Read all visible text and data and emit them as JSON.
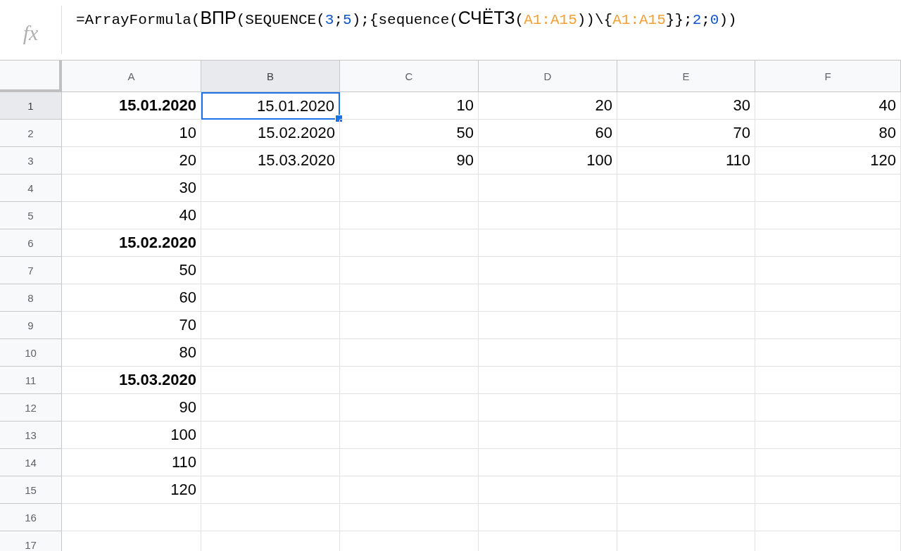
{
  "formula_bar": {
    "icon_label": "fx",
    "tokens": [
      {
        "text": "=ArrayFormula(",
        "kind": "code"
      },
      {
        "text": "ВПР",
        "kind": "name"
      },
      {
        "text": "(SEQUENCE(",
        "kind": "code"
      },
      {
        "text": "3",
        "kind": "number"
      },
      {
        "text": ";",
        "kind": "code"
      },
      {
        "text": "5",
        "kind": "number"
      },
      {
        "text": ");{sequence(",
        "kind": "code"
      },
      {
        "text": "СЧЁТЗ",
        "kind": "name"
      },
      {
        "text": "(",
        "kind": "code"
      },
      {
        "text": "A1:A15",
        "kind": "range"
      },
      {
        "text": "))\\{",
        "kind": "code"
      },
      {
        "text": "A1:A15",
        "kind": "range"
      },
      {
        "text": "}};",
        "kind": "code"
      },
      {
        "text": "2",
        "kind": "number"
      },
      {
        "text": ";",
        "kind": "code"
      },
      {
        "text": "0",
        "kind": "number"
      },
      {
        "text": "))",
        "kind": "code"
      }
    ]
  },
  "columns": [
    {
      "label": "A",
      "selected": false
    },
    {
      "label": "B",
      "selected": true
    },
    {
      "label": "C",
      "selected": false
    },
    {
      "label": "D",
      "selected": false
    },
    {
      "label": "E",
      "selected": false
    },
    {
      "label": "F",
      "selected": false
    }
  ],
  "rows": [
    {
      "number": "1",
      "selected": true,
      "cells": [
        {
          "value": "15.01.2020",
          "bold": true,
          "selected": false
        },
        {
          "value": "15.01.2020",
          "bold": false,
          "selected": true
        },
        {
          "value": "10",
          "bold": false,
          "selected": false
        },
        {
          "value": "20",
          "bold": false,
          "selected": false
        },
        {
          "value": "30",
          "bold": false,
          "selected": false
        },
        {
          "value": "40",
          "bold": false,
          "selected": false
        }
      ]
    },
    {
      "number": "2",
      "selected": false,
      "cells": [
        {
          "value": "10",
          "bold": false,
          "selected": false
        },
        {
          "value": "15.02.2020",
          "bold": false,
          "selected": false
        },
        {
          "value": "50",
          "bold": false,
          "selected": false
        },
        {
          "value": "60",
          "bold": false,
          "selected": false
        },
        {
          "value": "70",
          "bold": false,
          "selected": false
        },
        {
          "value": "80",
          "bold": false,
          "selected": false
        }
      ]
    },
    {
      "number": "3",
      "selected": false,
      "cells": [
        {
          "value": "20",
          "bold": false,
          "selected": false
        },
        {
          "value": "15.03.2020",
          "bold": false,
          "selected": false
        },
        {
          "value": "90",
          "bold": false,
          "selected": false
        },
        {
          "value": "100",
          "bold": false,
          "selected": false
        },
        {
          "value": "110",
          "bold": false,
          "selected": false
        },
        {
          "value": "120",
          "bold": false,
          "selected": false
        }
      ]
    },
    {
      "number": "4",
      "selected": false,
      "cells": [
        {
          "value": "30",
          "bold": false,
          "selected": false
        }
      ]
    },
    {
      "number": "5",
      "selected": false,
      "cells": [
        {
          "value": "40",
          "bold": false,
          "selected": false
        }
      ]
    },
    {
      "number": "6",
      "selected": false,
      "cells": [
        {
          "value": "15.02.2020",
          "bold": true,
          "selected": false
        }
      ]
    },
    {
      "number": "7",
      "selected": false,
      "cells": [
        {
          "value": "50",
          "bold": false,
          "selected": false
        }
      ]
    },
    {
      "number": "8",
      "selected": false,
      "cells": [
        {
          "value": "60",
          "bold": false,
          "selected": false
        }
      ]
    },
    {
      "number": "9",
      "selected": false,
      "cells": [
        {
          "value": "70",
          "bold": false,
          "selected": false
        }
      ]
    },
    {
      "number": "10",
      "selected": false,
      "cells": [
        {
          "value": "80",
          "bold": false,
          "selected": false
        }
      ]
    },
    {
      "number": "11",
      "selected": false,
      "cells": [
        {
          "value": "15.03.2020",
          "bold": true,
          "selected": false
        }
      ]
    },
    {
      "number": "12",
      "selected": false,
      "cells": [
        {
          "value": "90",
          "bold": false,
          "selected": false
        }
      ]
    },
    {
      "number": "13",
      "selected": false,
      "cells": [
        {
          "value": "100",
          "bold": false,
          "selected": false
        }
      ]
    },
    {
      "number": "14",
      "selected": false,
      "cells": [
        {
          "value": "110",
          "bold": false,
          "selected": false
        }
      ]
    },
    {
      "number": "15",
      "selected": false,
      "cells": [
        {
          "value": "120",
          "bold": false,
          "selected": false
        }
      ]
    },
    {
      "number": "16",
      "selected": false,
      "cells": []
    },
    {
      "number": "17",
      "selected": false,
      "cells": []
    }
  ]
}
